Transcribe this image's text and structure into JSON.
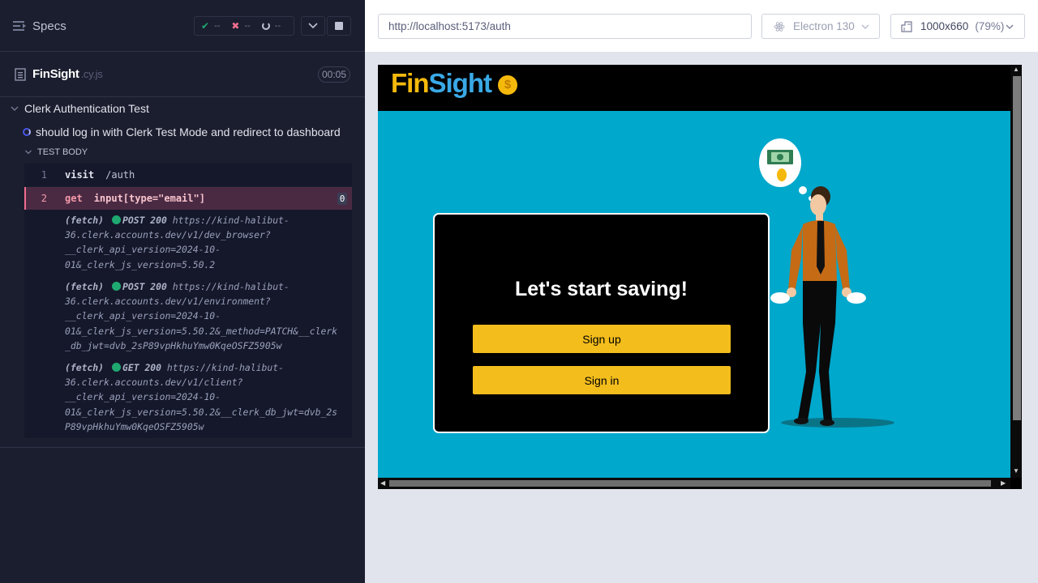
{
  "runner": {
    "specs_title": "Specs",
    "stats": {
      "passed": "--",
      "failed": "--",
      "pending": "--"
    },
    "file": {
      "name": "FinSight",
      "ext": ".cy.js",
      "duration": "00:05"
    },
    "suite": "Clerk Authentication Test",
    "test": "should log in with Clerk Test Mode and redirect to dashboard",
    "section": "TEST BODY",
    "commands": [
      {
        "num": "1",
        "name": "visit",
        "message": "/auth"
      },
      {
        "num": "2",
        "name": "get",
        "message": "input[type=\"email\"]",
        "count": "0"
      }
    ],
    "logs": [
      {
        "tag": "(fetch)",
        "method": "POST 200",
        "lines": [
          "https://kind-halibut-",
          "36.clerk.accounts.dev/v1/dev_browser?",
          "__clerk_api_version=2024-10-",
          "01&_clerk_js_version=5.50.2"
        ]
      },
      {
        "tag": "(fetch)",
        "method": "POST 200",
        "lines": [
          "https://kind-halibut-",
          "36.clerk.accounts.dev/v1/environment?",
          "__clerk_api_version=2024-10-",
          "01&_clerk_js_version=5.50.2&_method=PATCH&__clerk",
          "_db_jwt=dvb_2sP89vpHkhuYmw0KqeOSFZ5905w"
        ]
      },
      {
        "tag": "(fetch)",
        "method": "GET 200",
        "lines": [
          "https://kind-halibut-",
          "36.clerk.accounts.dev/v1/client?",
          "__clerk_api_version=2024-10-",
          "01&_clerk_js_version=5.50.2&__clerk_db_jwt=dvb_2s",
          "P89vpHkhuYmw0KqeOSFZ5905w"
        ]
      }
    ]
  },
  "browser_bar": {
    "url": "http://localhost:5173/auth",
    "browser": "Electron 130",
    "viewport": "1000x660",
    "zoom": "(79%)"
  },
  "app": {
    "logo_fin": "Fin",
    "logo_sight": "Sight",
    "coin": "$",
    "heading": "Let's start saving!",
    "sign_up": "Sign up",
    "sign_in": "Sign in",
    "colors": {
      "background": "#00a8cc",
      "button": "#f3bd1c",
      "logo_fin": "#f5b90c",
      "logo_sight": "#3aa9e6"
    }
  }
}
